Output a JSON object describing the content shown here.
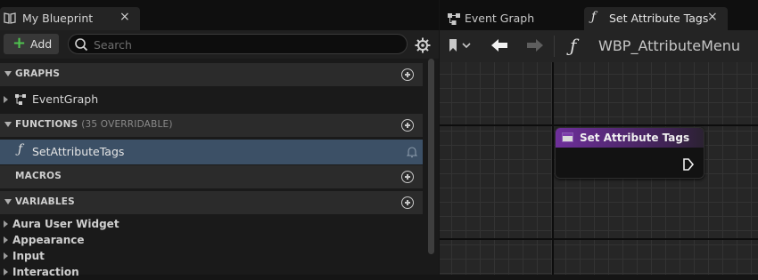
{
  "left_panel": {
    "tab": {
      "title": "My Blueprint",
      "close": "×"
    },
    "toolbar": {
      "add_label": "Add",
      "search_placeholder": "Search"
    },
    "sections": {
      "graphs": {
        "title": "GRAPHS"
      },
      "functions": {
        "title": "FUNCTIONS",
        "subtitle": "(35 OVERRIDABLE)"
      },
      "macros": {
        "title": "MACROS"
      },
      "variables": {
        "title": "VARIABLES"
      }
    },
    "graph_items": [
      {
        "label": "EventGraph"
      }
    ],
    "function_items": [
      {
        "label": "SetAttributeTags",
        "selected": true
      }
    ],
    "variable_categories": [
      {
        "label": "Aura User Widget"
      },
      {
        "label": "Appearance"
      },
      {
        "label": "Input"
      },
      {
        "label": "Interaction"
      }
    ]
  },
  "right_panel": {
    "tabs": [
      {
        "label": "Event Graph",
        "icon": "event-graph-icon",
        "active": false
      },
      {
        "label": "Set Attribute Tags",
        "icon": "function-icon",
        "active": true,
        "close": "×"
      }
    ],
    "breadcrumb": {
      "icon": "ƒ",
      "title": "WBP_AttributeMenu"
    },
    "node": {
      "title": "Set Attribute Tags",
      "header_color": "#6e2f9b"
    }
  },
  "colors": {
    "selection": "#3c5066",
    "add_plus": "#4fc24f",
    "graph_bg": "#262626"
  }
}
